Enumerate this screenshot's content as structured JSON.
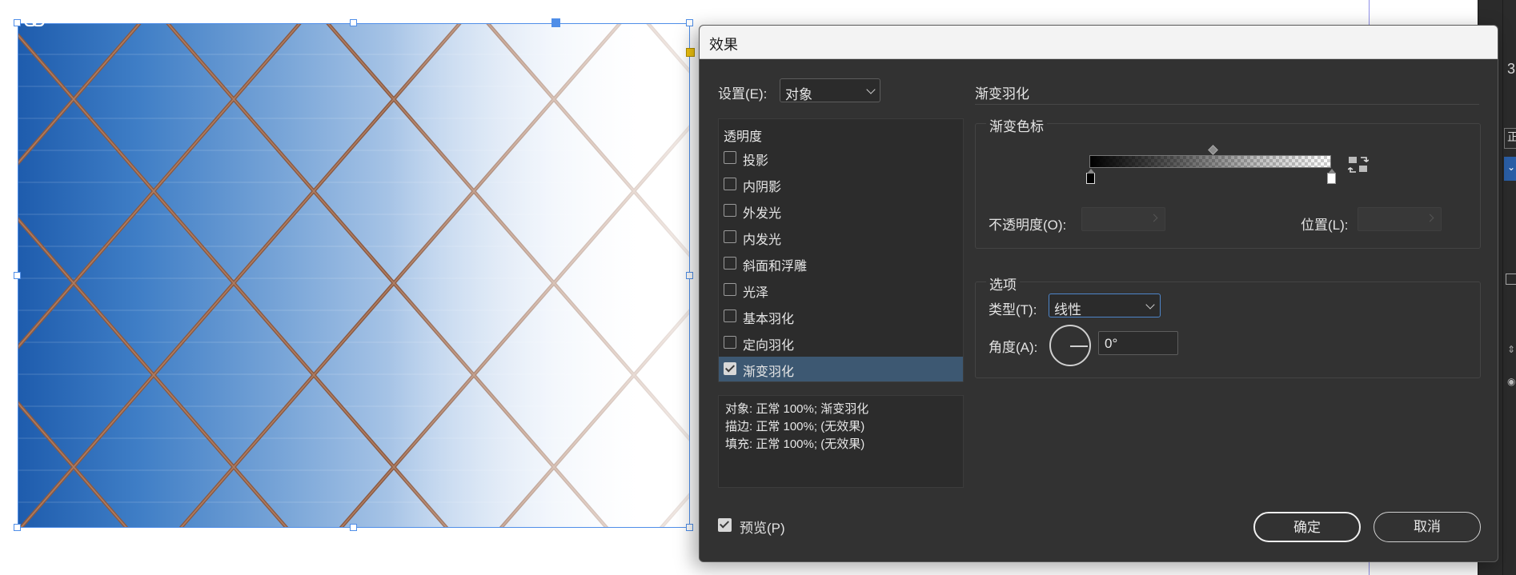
{
  "dialog": {
    "title": "效果",
    "settings_label": "设置(E):",
    "settings_value": "对象",
    "effects_header": "透明度",
    "effects": [
      {
        "label": "投影",
        "checked": false
      },
      {
        "label": "内阴影",
        "checked": false
      },
      {
        "label": "外发光",
        "checked": false
      },
      {
        "label": "内发光",
        "checked": false
      },
      {
        "label": "斜面和浮雕",
        "checked": false
      },
      {
        "label": "光泽",
        "checked": false
      },
      {
        "label": "基本羽化",
        "checked": false
      },
      {
        "label": "定向羽化",
        "checked": false
      },
      {
        "label": "渐变羽化",
        "checked": true
      }
    ],
    "summary": [
      "对象: 正常 100%; 渐变羽化",
      "描边: 正常 100%; (无效果)",
      "填充: 正常 100%; (无效果)"
    ],
    "preview_label": "预览(P)",
    "preview_checked": true,
    "section_title": "渐变羽化",
    "gradient_stops_title": "渐变色标",
    "opacity_label": "不透明度(O):",
    "opacity_value": "",
    "location_label": "位置(L):",
    "location_value": "",
    "options_title": "选项",
    "type_label": "类型(T):",
    "type_value": "线性",
    "angle_label": "角度(A):",
    "angle_value": "0°",
    "ok_label": "确定",
    "cancel_label": "取消"
  },
  "right_panel": {
    "number": "3",
    "field_char": "正"
  },
  "colors": {
    "dialog_bg": "#323232",
    "selection_blue": "#4f8ee8",
    "list_selected": "#3d5872",
    "sky_blue": "#1e5cad"
  }
}
